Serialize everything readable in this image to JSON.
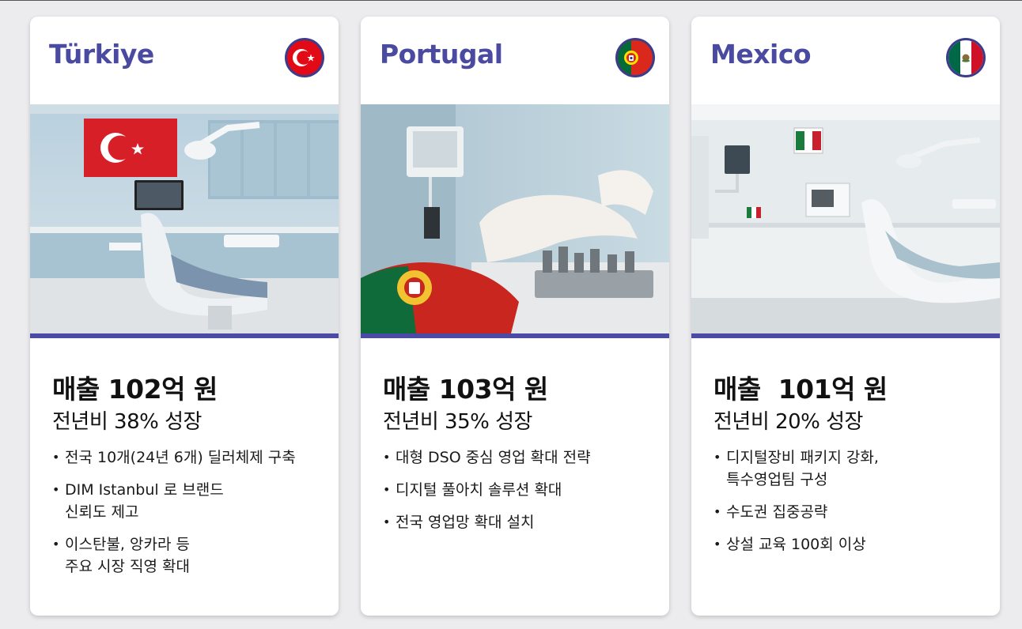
{
  "cards": [
    {
      "country": "Türkiye",
      "flag_icon": "turkey-flag-icon",
      "revenue": "매출 102억 원",
      "growth": "전년비 38% 성장",
      "bullets": [
        "전국 10개(24년 6개) 딜러체제 구축",
        "DIM Istanbul 로 브랜드\n신뢰도 제고",
        "이스탄불, 앙카라 등\n주요 시장 직영 확대"
      ]
    },
    {
      "country": "Portugal",
      "flag_icon": "portugal-flag-icon",
      "revenue": "매출 103억 원",
      "growth": "전년비 35% 성장",
      "bullets": [
        "대형 DSO 중심 영업 확대 전략",
        "디지털 풀아치 솔루션 확대",
        "전국 영업망 확대 설치"
      ]
    },
    {
      "country": "Mexico",
      "flag_icon": "mexico-flag-icon",
      "revenue": "매출  101억 원",
      "growth": "전년비 20% 성장",
      "bullets": [
        "디지털장비 패키지 강화,\n특수영업팀 구성",
        "수도권 집중공략",
        "상설 교육 100회 이상"
      ]
    }
  ],
  "colors": {
    "accent": "#4a4aa0",
    "bar": "#4b4ba5",
    "background": "#ececee"
  }
}
